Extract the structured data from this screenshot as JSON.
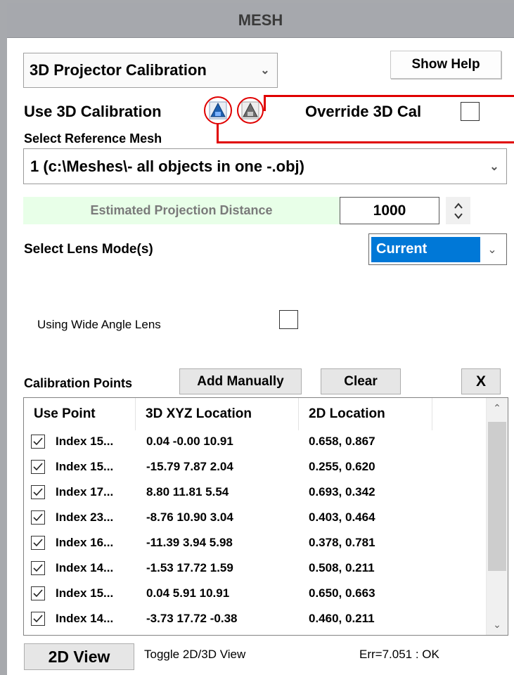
{
  "panel": {
    "title": "MESH"
  },
  "mode_select": {
    "value": "3D Projector Calibration"
  },
  "help": {
    "label": "Show Help"
  },
  "use_3d": {
    "label": "Use 3D Calibration",
    "override_label": "Override 3D Cal"
  },
  "reference_mesh": {
    "label": "Select Reference Mesh",
    "value": "1 (c:\\Meshes\\- all objects in one -.obj)"
  },
  "projection": {
    "label": "Estimated Projection Distance",
    "value": "1000"
  },
  "lens_mode": {
    "label": "Select Lens Mode(s)",
    "value": "Current"
  },
  "wide_angle": {
    "label": "Using Wide Angle Lens",
    "checked": false
  },
  "calibration": {
    "label": "Calibration Points",
    "add_label": "Add Manually",
    "clear_label": "Clear",
    "close_label": "X",
    "columns": [
      "Use Point",
      "3D XYZ Location",
      "2D Location"
    ],
    "rows": [
      {
        "checked": true,
        "point": "Index 15...",
        "xyz": "0.04 -0.00 10.91",
        "uv": "0.658, 0.867"
      },
      {
        "checked": true,
        "point": "Index 15...",
        "xyz": "-15.79 7.87 2.04",
        "uv": "0.255, 0.620"
      },
      {
        "checked": true,
        "point": "Index 17...",
        "xyz": "8.80 11.81 5.54",
        "uv": "0.693, 0.342"
      },
      {
        "checked": true,
        "point": "Index 23...",
        "xyz": "-8.76 10.90 3.04",
        "uv": "0.403, 0.464"
      },
      {
        "checked": true,
        "point": "Index 16...",
        "xyz": "-11.39 3.94 5.98",
        "uv": "0.378, 0.781"
      },
      {
        "checked": true,
        "point": "Index 14...",
        "xyz": "-1.53 17.72 1.59",
        "uv": "0.508, 0.211"
      },
      {
        "checked": true,
        "point": "Index 15...",
        "xyz": "0.04 5.91 10.91",
        "uv": "0.650, 0.663"
      },
      {
        "checked": true,
        "point": "Index 14...",
        "xyz": "-3.73 17.72 -0.38",
        "uv": "0.460, 0.211"
      }
    ]
  },
  "footer": {
    "view_label": "2D View",
    "toggle_text": "Toggle 2D/3D View",
    "status": "Err=7.051 : OK"
  },
  "colors": {
    "accent": "#0078d7",
    "highlight": "#e8ffe8",
    "callout": "#e00000"
  }
}
